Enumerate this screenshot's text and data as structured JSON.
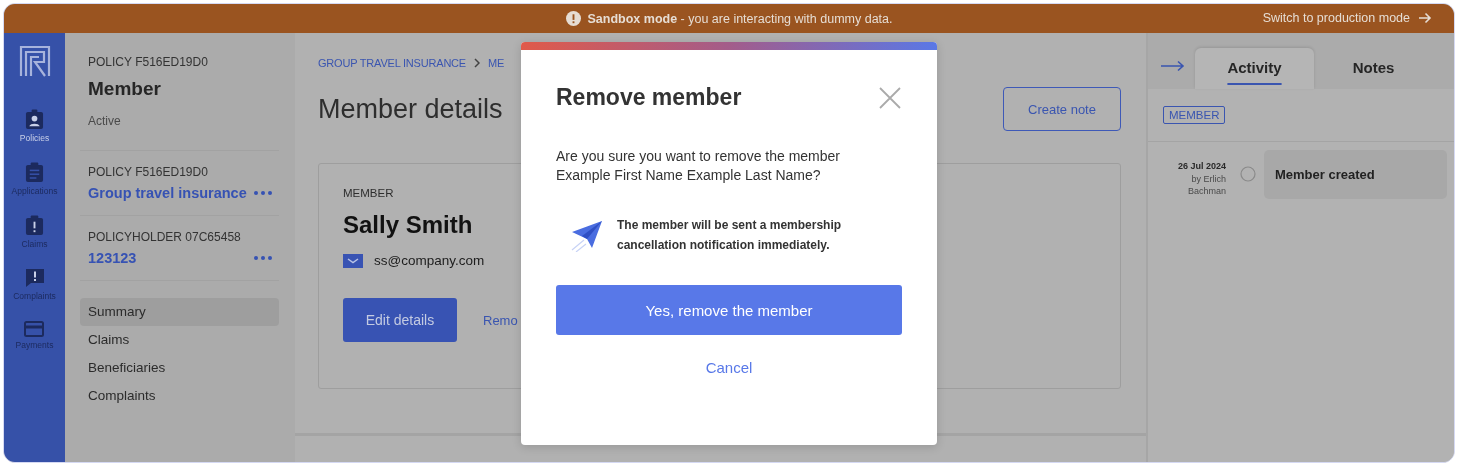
{
  "banner": {
    "message": "**Sandbox mode** - you are interacting with dummy data.",
    "action": "Switch to production mode"
  },
  "rail": [
    {
      "label": "Policies",
      "kind": "badge"
    },
    {
      "label": "Applications",
      "kind": "clipboard"
    },
    {
      "label": "Claims",
      "kind": "alert-clipboard"
    },
    {
      "label": "Complaints",
      "kind": "alert-bubble"
    },
    {
      "label": "Payments",
      "kind": "card"
    }
  ],
  "sidebar": {
    "eyebrow": "POLICY F516ED19D0",
    "title": "Member",
    "status": "Active",
    "sections": [
      {
        "label": "POLICY F516ED19D0",
        "value": "Group travel insurance"
      },
      {
        "label": "POLICYHOLDER 07C65458",
        "value": "123123"
      }
    ],
    "nav": [
      {
        "label": "Summary",
        "selected": true
      },
      {
        "label": "Claims",
        "selected": false
      },
      {
        "label": "Beneficiaries",
        "selected": false
      },
      {
        "label": "Complaints",
        "selected": false
      }
    ]
  },
  "main": {
    "breadcrumb": [
      "GROUP TRAVEL INSURANCE",
      "ME"
    ],
    "title": "Member details",
    "create_button": "Create note",
    "card": {
      "eyebrow": "MEMBER",
      "name": "Sally Smith",
      "email": "ss@company.com",
      "edit_button": "Edit details",
      "remove_link": "Remo"
    }
  },
  "activity_panel": {
    "tabs": [
      {
        "label": "Activity",
        "selected": true
      },
      {
        "label": "Notes",
        "selected": false
      }
    ],
    "filter_tag": "MEMBER",
    "events": [
      {
        "date": "26 Jul 2024",
        "author": "by Erlich Bachman",
        "text": "Member created"
      }
    ]
  },
  "modal": {
    "title": "Remove member",
    "question": "Are you sure you want to remove the member Example First Name Example Last Name?",
    "notice": "The member will be sent a membership cancellation notification immediately.",
    "confirm_button": "Yes, remove the member",
    "cancel_link": "Cancel"
  }
}
